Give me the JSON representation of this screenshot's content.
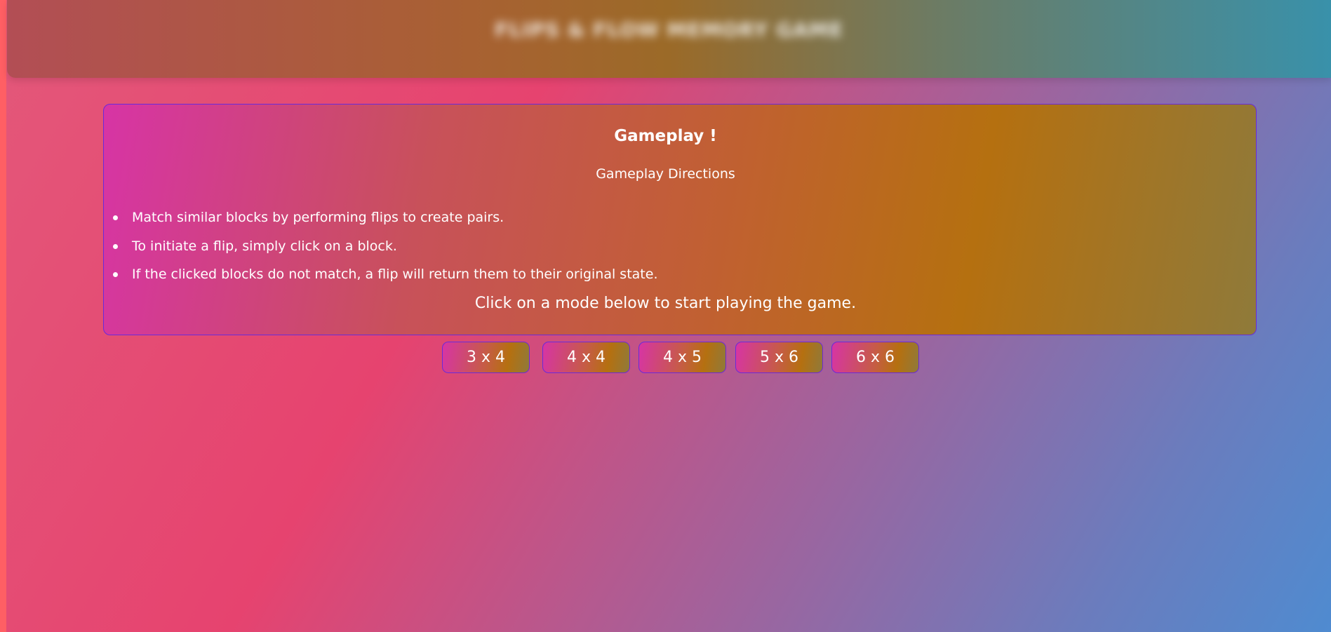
{
  "header": {
    "title": "FLIPS & FLOW MEMORY GAME"
  },
  "panel": {
    "title": "Gameplay !",
    "subtitle": "Gameplay Directions",
    "directions": [
      "Match similar blocks by performing flips to create pairs.",
      "To initiate a flip, simply click on a block.",
      "If the clicked blocks do not match, a flip will return them to their original state."
    ],
    "start_hint": "Click on a mode below to start playing the game."
  },
  "modes": [
    "3 x 4",
    "4 x 4",
    "4 x 5",
    "5 x 6",
    "6 x 6"
  ],
  "colors": {
    "border": "#6a2bd8",
    "text": "#ffffff",
    "panel_start": "#d734a5",
    "panel_end": "#8f7a3a"
  }
}
